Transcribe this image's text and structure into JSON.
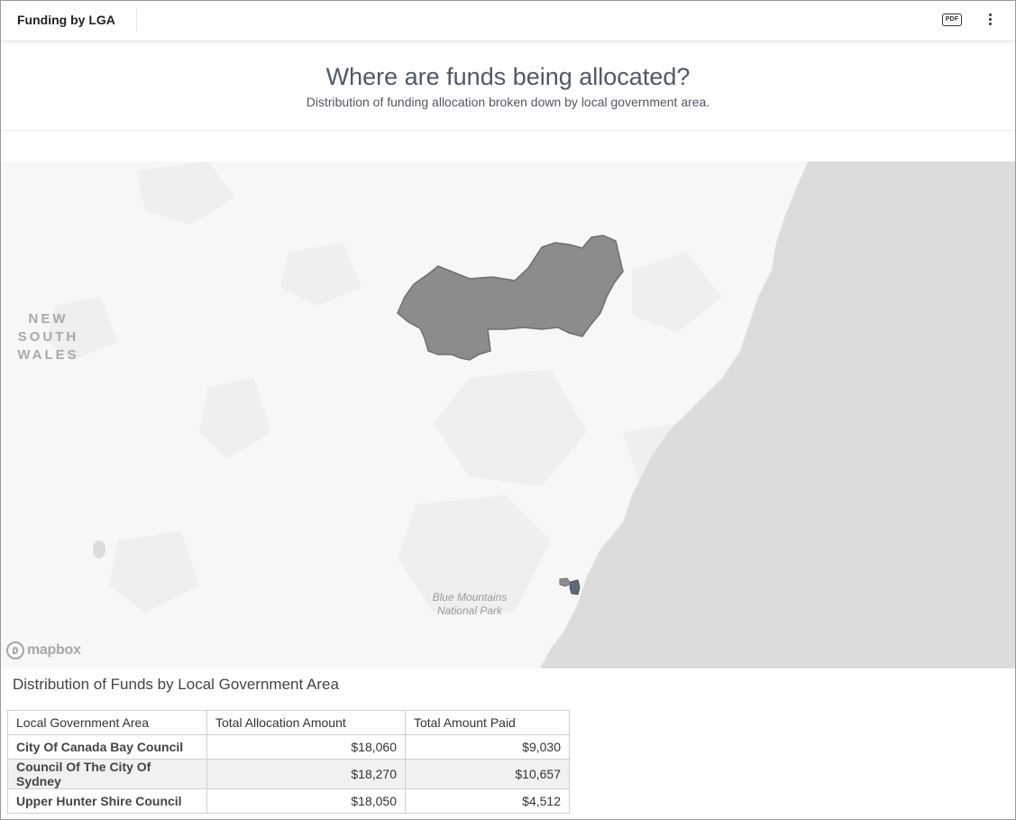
{
  "topbar": {
    "title": "Funding by LGA",
    "pdf_label": "PDF",
    "pdf_icon": "pdf-icon",
    "more_icon": "vertical-ellipsis-icon"
  },
  "header": {
    "title": "Where are funds being allocated?",
    "subtitle": "Distribution of funding allocation broken down by local government area."
  },
  "map": {
    "region_label_line1": "NEW SOUTH",
    "region_label_line2": "WALES",
    "park_label_line1": "Blue Mountains",
    "park_label_line2": "National Park",
    "attribution": "mapbox",
    "colors": {
      "land": "#f7f7f7",
      "ocean": "#dcdcdc",
      "highlight_region": "#8c8c8c",
      "small_region": "#5d6a78"
    }
  },
  "table": {
    "title": "Distribution of Funds by Local Government Area",
    "columns": [
      "Local Government Area",
      "Total Allocation Amount",
      "Total Amount Paid"
    ],
    "rows": [
      {
        "area": "City Of Canada Bay Council",
        "allocation": "$18,060",
        "paid": "$9,030"
      },
      {
        "area": "Council Of The City Of Sydney",
        "allocation": "$18,270",
        "paid": "$10,657"
      },
      {
        "area": "Upper Hunter Shire Council",
        "allocation": "$18,050",
        "paid": "$4,512"
      }
    ]
  }
}
